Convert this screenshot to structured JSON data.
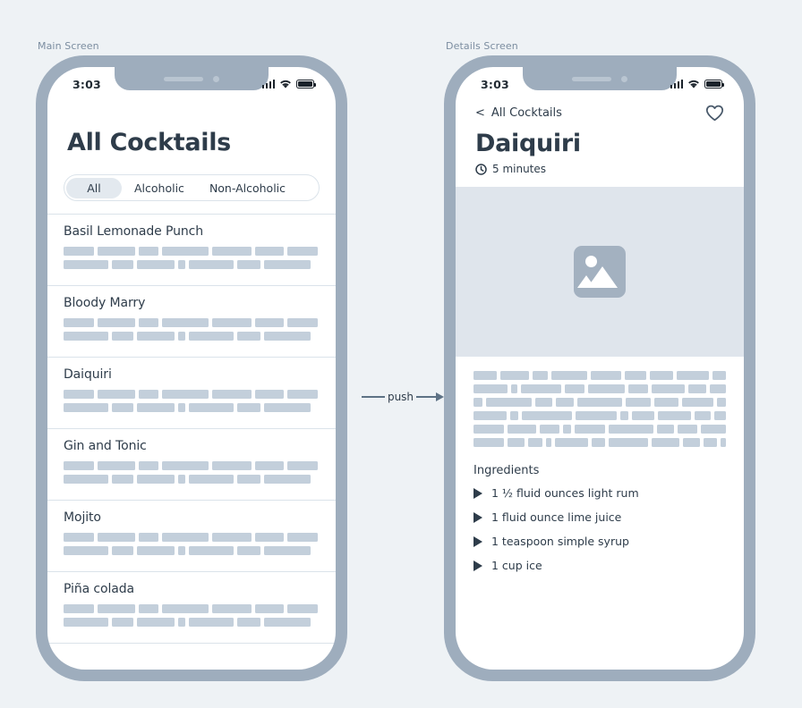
{
  "labels": {
    "main_screen": "Main Screen",
    "details_screen": "Details Screen"
  },
  "connector": {
    "label": "push",
    "arrow_icon": "arrow-right-icon"
  },
  "colors": {
    "background": "#eef2f5",
    "phone_frame": "#9eadbd",
    "screen": "#ffffff",
    "text": "#2e3c4a",
    "placeholder_bar": "#c3cfdb",
    "hero_background": "#dfe5ec",
    "divider": "#dbe3ea",
    "segment_active": "#e3e9ef",
    "label_text": "#7b8da0"
  },
  "status_bar": {
    "time": "3:03",
    "signal_icon": "cellular-signal-icon",
    "wifi_icon": "wifi-icon",
    "battery_icon": "battery-full-icon"
  },
  "main": {
    "title": "All Cocktails",
    "segmented_control": {
      "selected": "All",
      "options": [
        "All",
        "Alcoholic",
        "Non-Alcoholic"
      ]
    },
    "cocktails": [
      {
        "name": "Basil Lemonade Punch"
      },
      {
        "name": "Bloody Marry"
      },
      {
        "name": "Daiquiri"
      },
      {
        "name": "Gin and Tonic"
      },
      {
        "name": "Mojito"
      },
      {
        "name": "Piña colada"
      }
    ],
    "row_placeholder_rows": [
      [
        34,
        42,
        22,
        52,
        44,
        32,
        34
      ],
      [
        50,
        24,
        42,
        8,
        50,
        26,
        52
      ]
    ]
  },
  "details": {
    "back_label": "All Cocktails",
    "back_chevron": "<",
    "favorite_icon": "heart-outline-icon",
    "title": "Daiquiri",
    "time_icon": "clock-icon",
    "time_label": "5 minutes",
    "image_placeholder_icon": "image-placeholder-icon",
    "description_placeholder_rows": [
      [
        34,
        42,
        22,
        52,
        44,
        32,
        34,
        46,
        20
      ],
      [
        46,
        8,
        54,
        26,
        50,
        26,
        44,
        24,
        22
      ],
      [
        12,
        58,
        22,
        22,
        58,
        32,
        30,
        40,
        12
      ],
      [
        40,
        10,
        62,
        50,
        10,
        28,
        40,
        20,
        14
      ],
      [
        40,
        36,
        26,
        10,
        40,
        58,
        22,
        26,
        32
      ],
      [
        42,
        24,
        20,
        8,
        46,
        18,
        56,
        38,
        24,
        18,
        8
      ]
    ],
    "ingredients_title": "Ingredients",
    "ingredients": [
      "1 ½ fluid ounces light rum",
      "1 fluid ounce lime juice",
      "1 teaspoon simple syrup",
      "1 cup ice"
    ]
  }
}
